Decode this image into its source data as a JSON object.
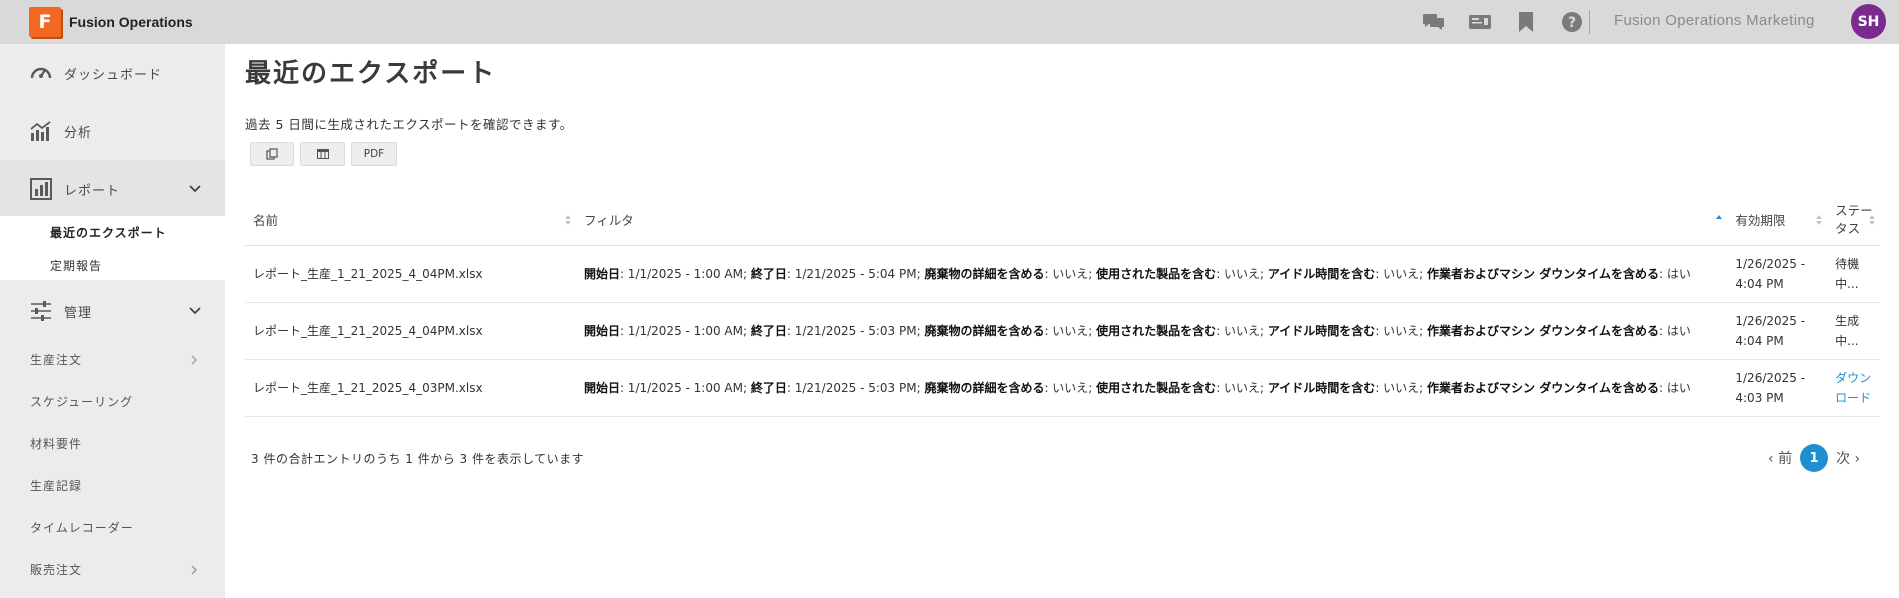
{
  "header": {
    "logo_letter": "F",
    "app_title": "Fusion Operations",
    "icons": [
      "chat-icon",
      "id-card-icon",
      "bookmark-icon",
      "help-icon"
    ],
    "org_name": "Fusion Operations Marketing",
    "avatar_initials": "SH",
    "avatar_color": "#7b2b8f"
  },
  "sidebar": {
    "dashboard": "ダッシュボード",
    "analytics": "分析",
    "reports": "レポート",
    "reports_sub": [
      "最近のエクスポート",
      "定期報告"
    ],
    "admin": "管理",
    "items": [
      {
        "label": "生産注文",
        "has_chevron": true
      },
      {
        "label": "スケジューリング",
        "has_chevron": false
      },
      {
        "label": "材料要件",
        "has_chevron": false
      },
      {
        "label": "生産記録",
        "has_chevron": false
      },
      {
        "label": "タイムレコーダー",
        "has_chevron": false
      },
      {
        "label": "販売注文",
        "has_chevron": true
      }
    ]
  },
  "main": {
    "title": "最近のエクスポート",
    "subtitle": "過去 5 日間に生成されたエクスポートを確認できます。",
    "buttons": {
      "copy_icon": "copy-icon",
      "csv_icon": "table-icon",
      "pdf": "PDF"
    },
    "columns": [
      "名前",
      "フィルタ",
      "有効期限",
      "ステータス"
    ],
    "rows": [
      {
        "name": "レポート_生産_1_21_2025_4_04PM.xlsx",
        "filter": [
          {
            "k": "開始日",
            "v": ": 1/1/2025 - 1:00 AM; "
          },
          {
            "k": "終了日",
            "v": ": 1/21/2025 - 5:04 PM; "
          },
          {
            "k": "廃棄物の詳細を含める",
            "v": ": いいえ; "
          },
          {
            "k": "使用された製品を含む",
            "v": ": いいえ; "
          },
          {
            "k": "アイドル時間を含む",
            "v": ": いいえ; "
          },
          {
            "k": "作業者およびマシン ダウンタイムを含める",
            "v": ": はい"
          }
        ],
        "expires": "1/26/2025 - 4:04 PM",
        "status": "待機中...",
        "status_link": false
      },
      {
        "name": "レポート_生産_1_21_2025_4_04PM.xlsx",
        "filter": [
          {
            "k": "開始日",
            "v": ": 1/1/2025 - 1:00 AM; "
          },
          {
            "k": "終了日",
            "v": ": 1/21/2025 - 5:03 PM; "
          },
          {
            "k": "廃棄物の詳細を含める",
            "v": ": いいえ; "
          },
          {
            "k": "使用された製品を含む",
            "v": ": いいえ; "
          },
          {
            "k": "アイドル時間を含む",
            "v": ": いいえ; "
          },
          {
            "k": "作業者およびマシン ダウンタイムを含める",
            "v": ": はい"
          }
        ],
        "expires": "1/26/2025 - 4:04 PM",
        "status": "生成中...",
        "status_link": false
      },
      {
        "name": "レポート_生産_1_21_2025_4_03PM.xlsx",
        "filter": [
          {
            "k": "開始日",
            "v": ": 1/1/2025 - 1:00 AM; "
          },
          {
            "k": "終了日",
            "v": ": 1/21/2025 - 5:03 PM; "
          },
          {
            "k": "廃棄物の詳細を含める",
            "v": ": いいえ; "
          },
          {
            "k": "使用された製品を含む",
            "v": ": いいえ; "
          },
          {
            "k": "アイドル時間を含む",
            "v": ": いいえ; "
          },
          {
            "k": "作業者およびマシン ダウンタイムを含める",
            "v": ": はい"
          }
        ],
        "expires": "1/26/2025 - 4:03 PM",
        "status": "ダウンロード",
        "status_link": true
      }
    ],
    "footer": "3 件の合計エントリのうち 1 件から 3 件を表示しています",
    "pagination": {
      "prev": "前",
      "current": "1",
      "next": "次"
    }
  },
  "colors": {
    "accent": "#1f8fd1",
    "brand": "#f26722",
    "sidebar_bg": "#ececec",
    "topbar_bg": "#d9d9d9"
  }
}
